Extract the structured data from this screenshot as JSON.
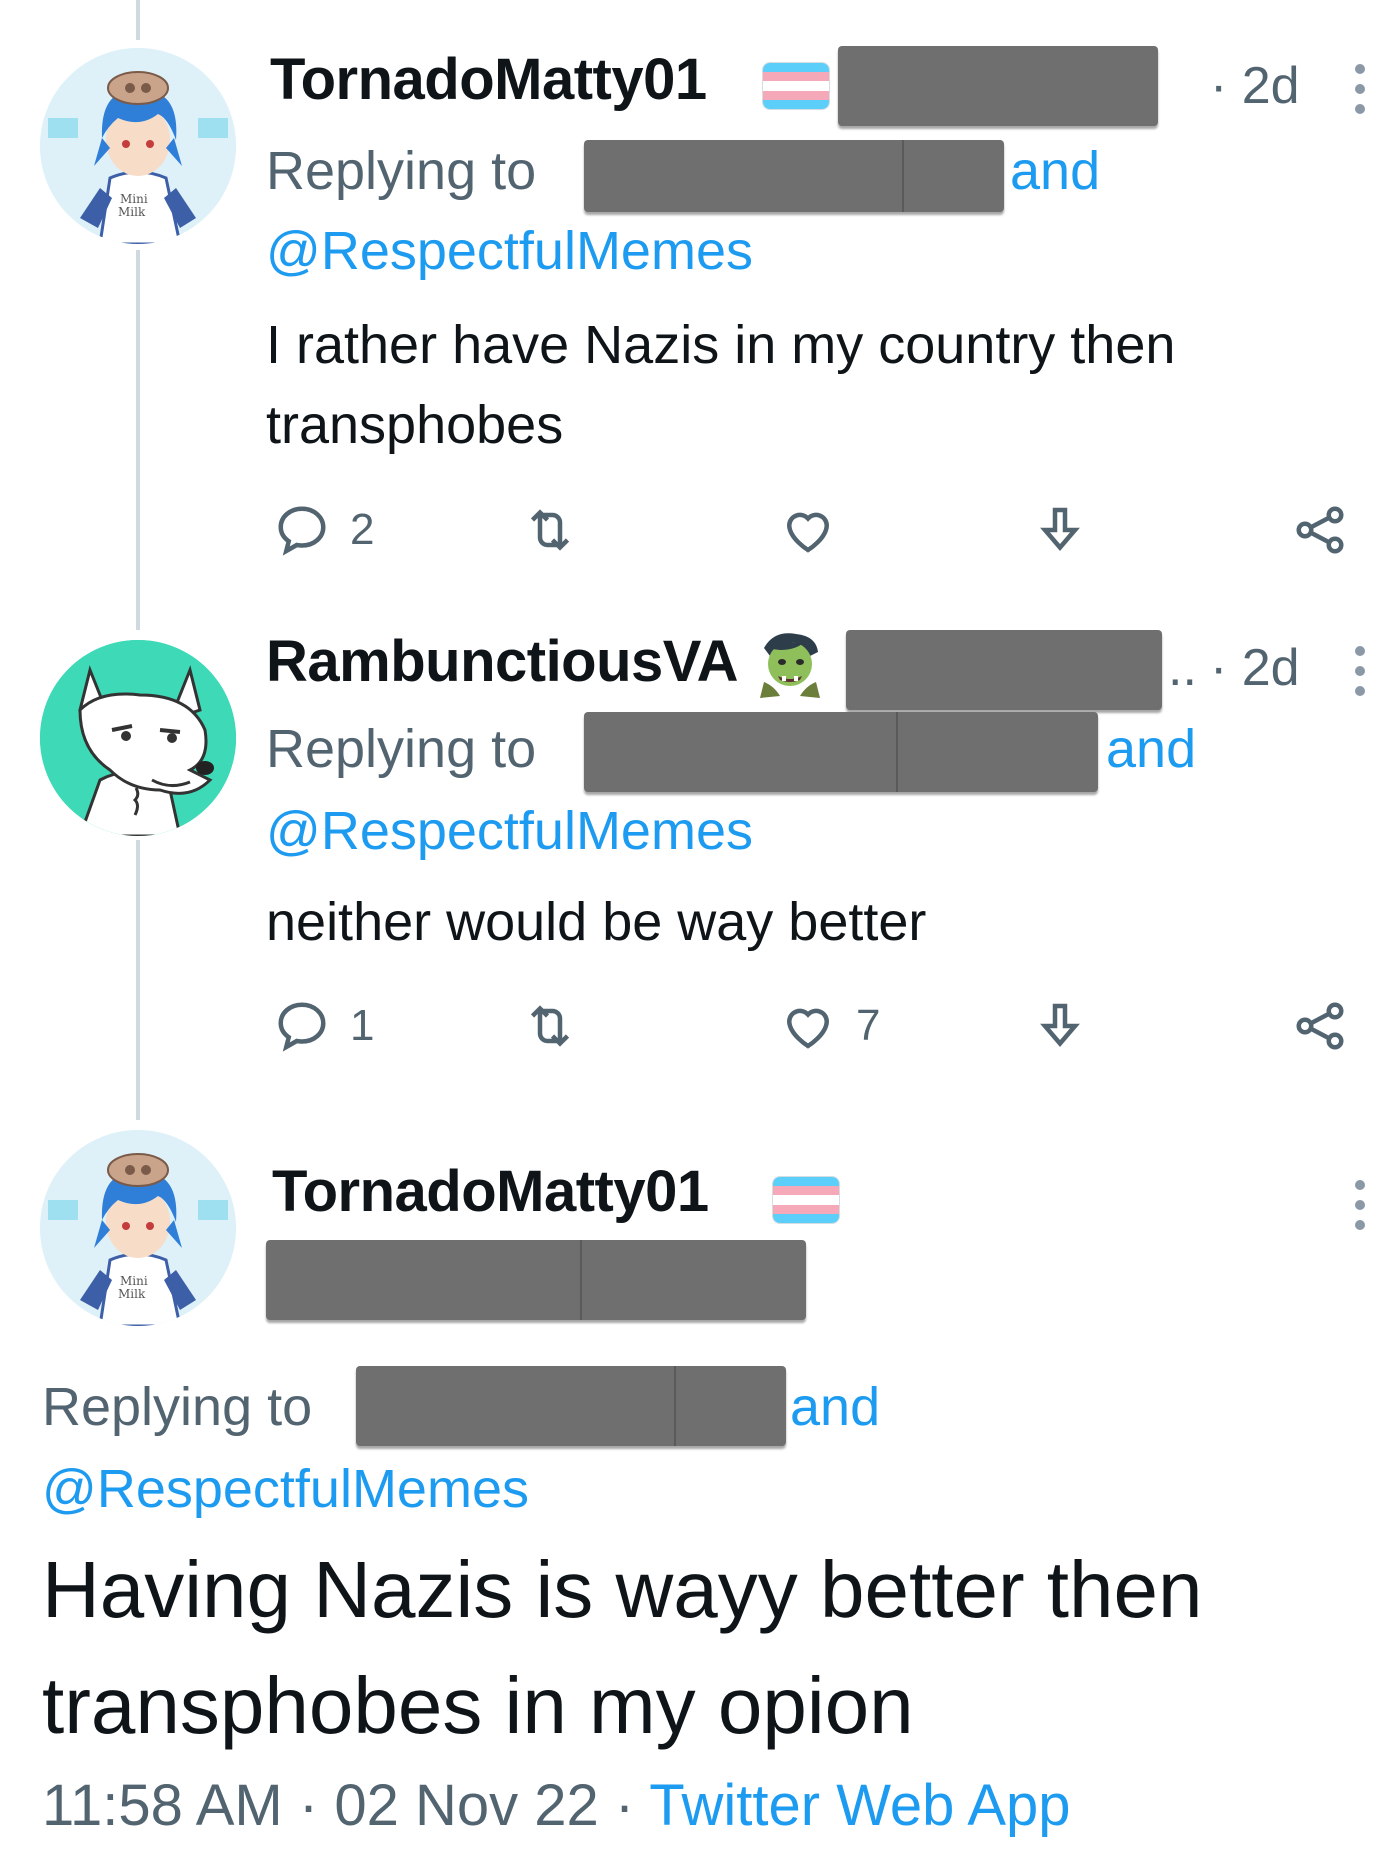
{
  "tweets": [
    {
      "author": "TornadoMatty01",
      "time": "· 2d",
      "replying_label": "Replying to",
      "and_label": "and",
      "mention": "@RespectfulMemes",
      "text": "I rather have Nazis in my country then transphobes",
      "actions": {
        "replies": "2",
        "retweets": "",
        "likes": ""
      }
    },
    {
      "author": "RambunctiousVA",
      "ellipsis": "..",
      "time": "· 2d",
      "replying_label": "Replying to",
      "and_label": "and",
      "mention": "@RespectfulMemes",
      "text": "neither would be way better",
      "actions": {
        "replies": "1",
        "retweets": "",
        "likes": "7"
      }
    },
    {
      "author": "TornadoMatty01",
      "replying_label": "Replying to",
      "and_label": "and",
      "mention": "@RespectfulMemes",
      "text": "Having Nazis is wayy better then transphobes in my opion",
      "time_of_day": "11:58 AM",
      "separator": "·",
      "date": "02 Nov 22",
      "source": "Twitter Web App"
    }
  ],
  "avatar_labels": {
    "shirt_text": "Mini Milk"
  },
  "colors": {
    "link": "#1d9bf0",
    "muted": "#536471",
    "redaction": "#6f6f6f",
    "flag_blue": "#5bcefa",
    "flag_pink": "#f5a9b8",
    "wolf_avatar_bg": "#3ed9b6"
  },
  "icons": [
    "reply-icon",
    "retweet-icon",
    "like-icon",
    "bookmark-icon",
    "share-icon",
    "more-icon",
    "trans-flag-icon",
    "zombie-emoji-icon"
  ]
}
